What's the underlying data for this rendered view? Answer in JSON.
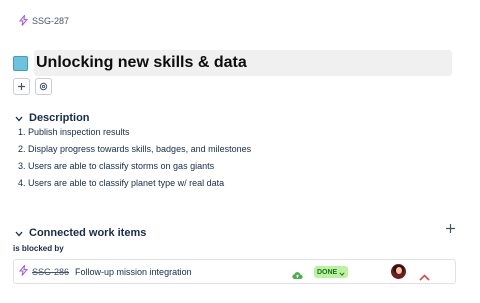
{
  "breadcrumb": {
    "issue_key": "SSG-287",
    "icon": "lightning-icon"
  },
  "header": {
    "title": "Unlocking new skills & data",
    "color_swatch": "#6cc3e0",
    "actions": [
      {
        "icon": "plus-icon"
      },
      {
        "icon": "settings-icon"
      }
    ]
  },
  "description": {
    "heading": "Description",
    "items": [
      "1. Publish inspection results",
      "2. Display progress towards skills, badges, and milestones",
      "3. Users are able to classify storms on gas giants",
      "4. Users are able to classify planet type w/ real data"
    ]
  },
  "connected_work_items": {
    "heading": "Connected work items",
    "add_icon": "plus-icon",
    "relationship_label": "is blocked by",
    "items": [
      {
        "key": "SSG-286",
        "summary": "Follow-up mission integration",
        "type_icon": "lightning-icon",
        "environment_icon": "cloud-upload-icon",
        "status": "DONE",
        "status_color": "#baf3a0",
        "priority_icon": "priority-high-icon",
        "priority_color": "#e2483d"
      }
    ]
  }
}
